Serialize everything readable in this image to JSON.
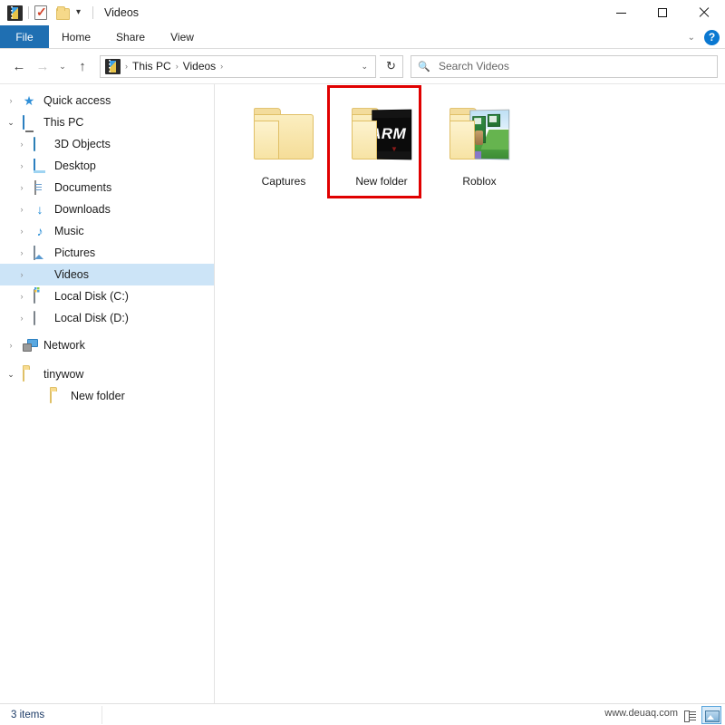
{
  "window": {
    "title": "Videos",
    "quick_access_icons": [
      "video-library-icon",
      "properties-icon",
      "new-folder-icon"
    ],
    "qat_dropdown": "▾",
    "minimize_label": "",
    "maximize_label": "",
    "close_label": ""
  },
  "ribbon": {
    "tabs": [
      {
        "label": "File",
        "active": true
      },
      {
        "label": "Home",
        "active": false
      },
      {
        "label": "Share",
        "active": false
      },
      {
        "label": "View",
        "active": false
      }
    ],
    "collapse_chevron": "⌄",
    "help_label": "?"
  },
  "navbar": {
    "back": "←",
    "forward": "→",
    "recent": "⌄",
    "up": "↑",
    "breadcrumbs": [
      "This PC",
      "Videos"
    ],
    "breadcrumb_separator": "›",
    "address_dropdown": "⌄",
    "refresh": "↻"
  },
  "search": {
    "placeholder": "Search Videos",
    "icon": "search-icon"
  },
  "sidebar": {
    "items": [
      {
        "label": "Quick access",
        "depth": 0,
        "expander": "›",
        "expanded": false,
        "icon": "star-icon",
        "selected": false
      },
      {
        "label": "This PC",
        "depth": 0,
        "expander": "⌄",
        "expanded": true,
        "icon": "computer-icon",
        "selected": false
      },
      {
        "label": "3D Objects",
        "depth": 1,
        "expander": "›",
        "expanded": false,
        "icon": "3d-objects-icon",
        "selected": false
      },
      {
        "label": "Desktop",
        "depth": 1,
        "expander": "›",
        "expanded": false,
        "icon": "desktop-icon",
        "selected": false
      },
      {
        "label": "Documents",
        "depth": 1,
        "expander": "›",
        "expanded": false,
        "icon": "documents-icon",
        "selected": false
      },
      {
        "label": "Downloads",
        "depth": 1,
        "expander": "›",
        "expanded": false,
        "icon": "downloads-icon",
        "selected": false
      },
      {
        "label": "Music",
        "depth": 1,
        "expander": "›",
        "expanded": false,
        "icon": "music-icon",
        "selected": false
      },
      {
        "label": "Pictures",
        "depth": 1,
        "expander": "›",
        "expanded": false,
        "icon": "pictures-icon",
        "selected": false
      },
      {
        "label": "Videos",
        "depth": 1,
        "expander": "›",
        "expanded": false,
        "icon": "videos-icon",
        "selected": true
      },
      {
        "label": "Local Disk (C:)",
        "depth": 1,
        "expander": "›",
        "expanded": false,
        "icon": "system-drive-icon",
        "selected": false
      },
      {
        "label": "Local Disk (D:)",
        "depth": 1,
        "expander": "›",
        "expanded": false,
        "icon": "drive-icon",
        "selected": false
      },
      {
        "label": "Network",
        "depth": 0,
        "expander": "›",
        "expanded": false,
        "icon": "network-icon",
        "selected": false
      },
      {
        "label": "tinywow",
        "depth": 0,
        "expander": "⌄",
        "expanded": true,
        "icon": "folder-icon",
        "selected": false
      },
      {
        "label": "New folder",
        "depth": 2,
        "expander": "",
        "expanded": false,
        "icon": "folder-icon",
        "selected": false
      }
    ]
  },
  "content": {
    "items": [
      {
        "label": "Captures",
        "thumbnail": "plain-folder",
        "highlighted": false
      },
      {
        "label": "New folder",
        "thumbnail": "armu-video-folder",
        "highlighted": true
      },
      {
        "label": "Roblox",
        "thumbnail": "roblox-video-folder",
        "highlighted": false
      }
    ],
    "thumbnail_text": {
      "armu": "ARM U",
      "armu_mark": "▼"
    },
    "highlight_color": "#e00000"
  },
  "statusbar": {
    "item_count": "3 items",
    "watermark": "www.deuaq.com",
    "views": [
      {
        "name": "details-view",
        "active": false
      },
      {
        "name": "large-icons-view",
        "active": true
      }
    ]
  }
}
